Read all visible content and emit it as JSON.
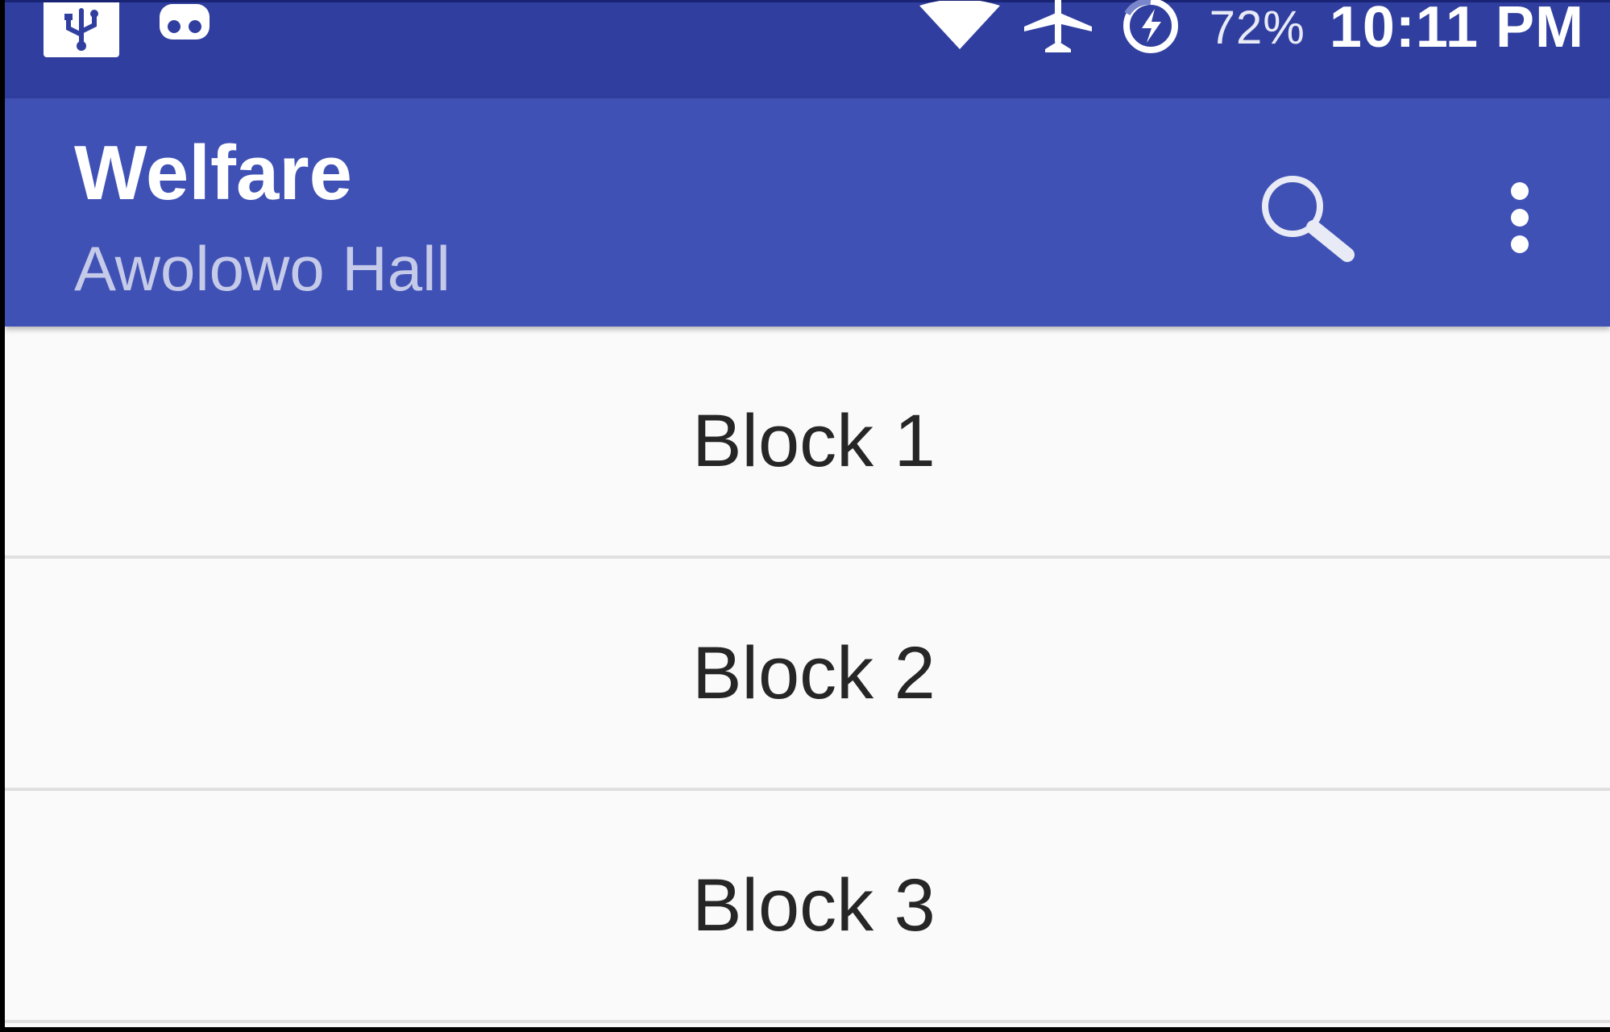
{
  "status_bar": {
    "battery_percent": "72%",
    "time": "10:11 PM",
    "left_icons": [
      "usb-icon",
      "voicemail-icon"
    ],
    "right_icons": [
      "wifi-icon",
      "airplane-mode-icon",
      "battery-saver-icon"
    ]
  },
  "app_bar": {
    "title": "Welfare",
    "subtitle": "Awolowo Hall",
    "actions": [
      "search-icon",
      "more-options-icon"
    ]
  },
  "list": {
    "items": [
      {
        "label": "Block 1"
      },
      {
        "label": "Block 2"
      },
      {
        "label": "Block 3"
      }
    ]
  },
  "colors": {
    "status_bar": "#303f9f",
    "app_bar": "#3f51b5",
    "subtitle": "#c5cae9",
    "list_background": "#fafafa",
    "divider": "#e0e0e0",
    "list_text": "#262626"
  }
}
